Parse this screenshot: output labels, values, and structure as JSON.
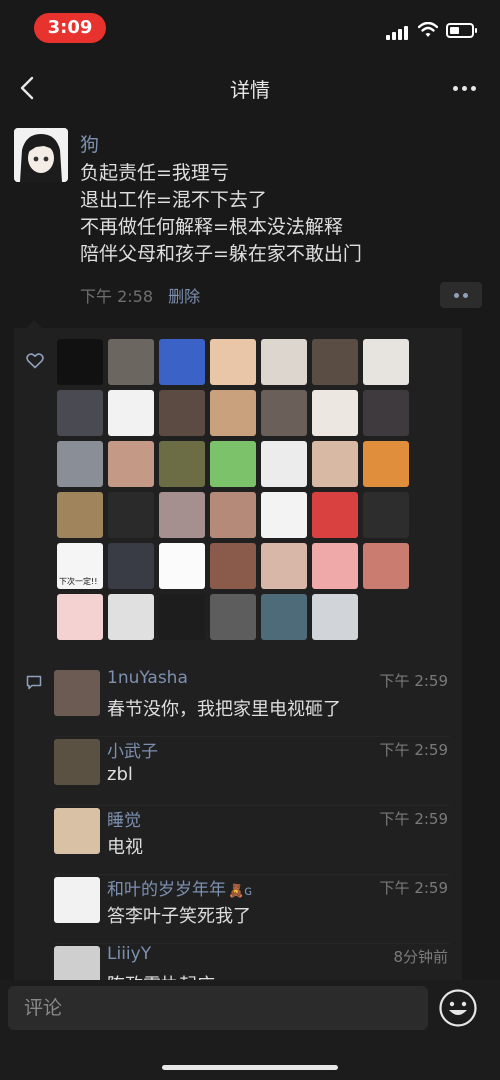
{
  "status_bar": {
    "time": "3:09",
    "time_pill_color": "#e8322e",
    "battery_level": 0.45
  },
  "nav": {
    "title": "详情",
    "back_icon": "chevron-left-icon",
    "more_icon": "more-dots-icon"
  },
  "post": {
    "author": "狗",
    "lines": [
      "负起责任=我理亏",
      "退出工作=混不下去了",
      "不再做任何解释=根本没法解释",
      "陪伴父母和孩子=躲在家不敢出门"
    ],
    "time": "下午 2:58",
    "delete_label": "删除"
  },
  "likes": {
    "icon": "heart-outline-icon",
    "avatar_colors": [
      "#111111",
      "#6b6660",
      "#3a62c7",
      "#e9c6a8",
      "#dcd6cf",
      "#5a4d44",
      "#e7e3df",
      "#4a4a52",
      "#f2f2f2",
      "#5c4b43",
      "#c9a27d",
      "#6b5f5a",
      "#ede7e1",
      "#3f3a3d",
      "#8a8f97",
      "#c49a86",
      "#6d6d45",
      "#7cc26a",
      "#ececec",
      "#d7b9a4",
      "#e08d3c",
      "#a0845b",
      "#2a2a2a",
      "#a68f8f",
      "#b58a78",
      "#f3f3f3",
      "#d94040",
      "#2d2d2d",
      "#f5f5f5",
      "#3a3c45",
      "#fbfbfb",
      "#8a5a4a",
      "#d8b7a8",
      "#f0a9a9",
      "#c97c6f",
      "#f4d2d2",
      "#e0e0e0",
      "#1d1d1d",
      "#5d5d5d",
      "#4d6b78",
      "#d1d4d8"
    ],
    "avatar_texts": {
      "28": "下次一定!!"
    }
  },
  "comments": {
    "icon": "comment-bubble-icon",
    "items": [
      {
        "name": "1nuYasha",
        "time": "下午 2:59",
        "text": "春节没你，我把家里电视砸了",
        "avatar_color": "#6b5b52"
      },
      {
        "name": "小武子",
        "time": "下午 2:59",
        "text": "zbl",
        "avatar_color": "#5a5142"
      },
      {
        "name": "睡觉",
        "time": "下午 2:59",
        "text": "电视",
        "avatar_color": "#d9c1a6"
      },
      {
        "name": "和叶的岁岁年年",
        "badge": "🧸ɢ",
        "time": "下午 2:59",
        "text": "答李叶子笑死我了",
        "avatar_color": "#f2f2f2"
      },
      {
        "name": "LiiiyY",
        "time": "8分钟前",
        "text": "陈政雷执起床",
        "avatar_color": "#cfcfcf"
      }
    ]
  },
  "input": {
    "placeholder": "评论",
    "emoji_icon": "emoji-smile-icon"
  },
  "colors": {
    "background": "#191919",
    "panel": "#202020",
    "link_blue": "#7d90b0"
  }
}
